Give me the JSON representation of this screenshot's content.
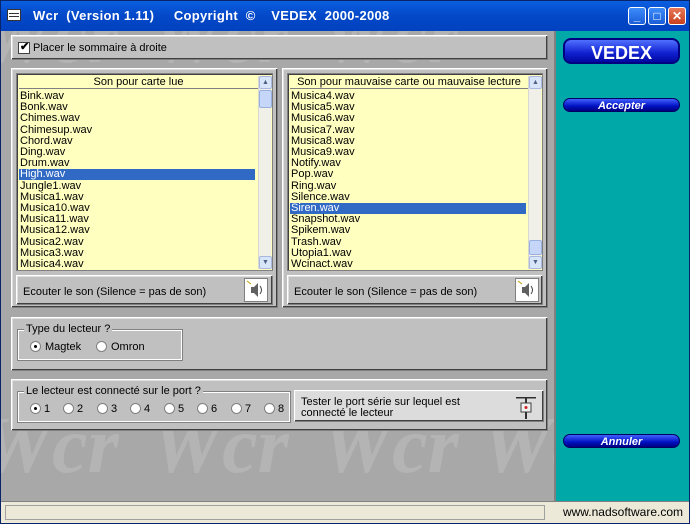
{
  "window": {
    "title": "Wcr  (Version 1.11)     Copyright  ©    VEDEX  2000-2008",
    "minimize_glyph": "_",
    "maximize_glyph": "□",
    "close_glyph": "✕"
  },
  "watermark": {
    "text": "Wcr"
  },
  "options": {
    "sommaire_label": "Placer le sommaire à droite",
    "sommaire_checked": true
  },
  "list_left": {
    "header": "Son pour carte lue",
    "items": [
      "Bink.wav",
      "Bonk.wav",
      "Chimes.wav",
      "Chimesup.wav",
      "Chord.wav",
      "Ding.wav",
      "Drum.wav",
      "High.wav",
      "Jungle1.wav",
      "Musica1.wav",
      "Musica10.wav",
      "Musica11.wav",
      "Musica12.wav",
      "Musica2.wav",
      "Musica3.wav",
      "Musica4.wav"
    ],
    "selected": "High.wav",
    "play_label": "Ecouter le son (Silence = pas de son)"
  },
  "list_right": {
    "header": "Son pour mauvaise carte ou mauvaise lecture",
    "items": [
      "Musica4.wav",
      "Musica5.wav",
      "Musica6.wav",
      "Musica7.wav",
      "Musica8.wav",
      "Musica9.wav",
      "Notify.wav",
      "Pop.wav",
      "Ring.wav",
      "Silence.wav",
      "Siren.wav",
      "Snapshot.wav",
      "Spikem.wav",
      "Trash.wav",
      "Utopia1.wav",
      "Wcinact.wav"
    ],
    "selected": "Siren.wav",
    "play_label": "Ecouter le son (Silence = pas de son)"
  },
  "reader_type": {
    "title": "Type du lecteur ?",
    "options": [
      "Magtek",
      "Omron"
    ],
    "selected": "Magtek"
  },
  "port": {
    "title": "Le lecteur est connecté sur le port ?",
    "options": [
      "1",
      "2",
      "3",
      "4",
      "5",
      "6",
      "7",
      "8"
    ],
    "selected": "1",
    "test_label": "Tester le port série sur lequel est connecté le lecteur"
  },
  "sidebar": {
    "brand": "VEDEX",
    "accept_label": "Accepter",
    "cancel_label": "Annuler"
  },
  "statusbar": {
    "url": "www.nadsoftware.com"
  },
  "colors": {
    "title_bar": "#0348c8",
    "list_bg": "#ffffc0",
    "selection": "#316ac5",
    "sidebar": "#00a8a8"
  }
}
